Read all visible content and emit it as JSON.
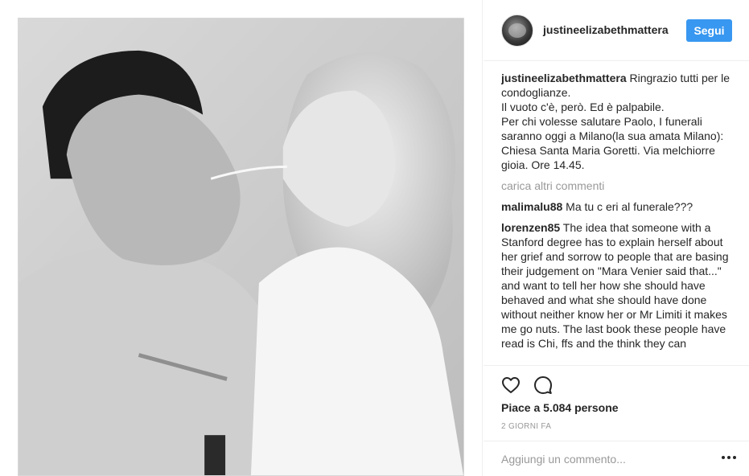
{
  "post": {
    "image_alt": "Black-and-white photo of a man and a woman sharing a strand of spaghetti"
  },
  "header": {
    "username": "justineelizabethmattera",
    "follow_label": "Segui"
  },
  "caption": {
    "user": "justineelizabethmattera",
    "text": "Ringrazio tutti per le condoglianze.\nIl vuoto c'è, però. Ed è palpabile.\nPer chi volesse salutare Paolo, I funerali saranno oggi a Milano(la sua amata Milano): Chiesa Santa Maria Goretti. Via melchiorre gioia. Ore 14.45."
  },
  "load_more_label": "carica altri commenti",
  "comments": [
    {
      "user": "malimalu88",
      "text": "Ma tu c eri al funerale???"
    },
    {
      "user": "lorenzen85",
      "text": "The idea that someone with a Stanford degree has to explain herself about her grief and sorrow to people that are basing their judgement on \"Mara Venier said that...\" and want to tell her how she should have behaved and what she should have done without neither know her or Mr Limiti it makes me go nuts. The last book these people have read is Chi, ffs and the think they can"
    }
  ],
  "likes_text": "Piace a 5.084 persone",
  "time_text": "2 GIORNI FA",
  "add_comment": {
    "placeholder": "Aggiungi un commento..."
  },
  "icons": {
    "like": "heart-icon",
    "comment": "comment-icon",
    "more": "more-options-icon"
  },
  "colors": {
    "accent": "#3897f0",
    "muted": "#999999",
    "text": "#262626"
  }
}
